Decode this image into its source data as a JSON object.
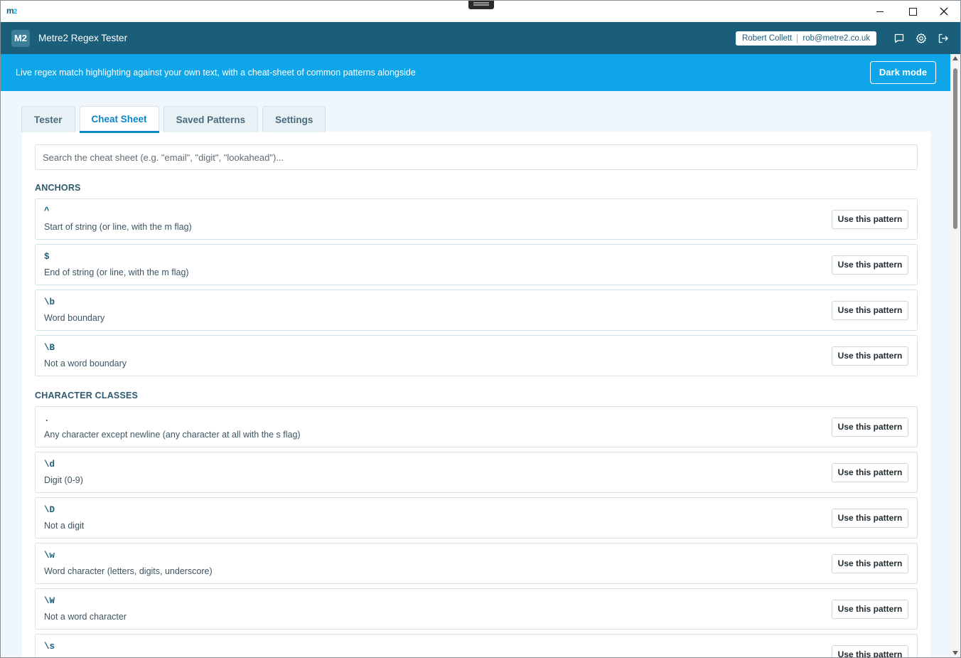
{
  "window": {
    "logo": "m",
    "logo_sub": "2"
  },
  "header": {
    "badge": "M2",
    "title": "Metre2 Regex Tester",
    "user_name": "Robert Collett",
    "user_email": "rob@metre2.co.uk"
  },
  "banner": {
    "text": "Live regex match highlighting against your own text, with a cheat-sheet of common patterns alongside",
    "dark_mode_label": "Dark mode"
  },
  "tabs": [
    {
      "label": "Tester"
    },
    {
      "label": "Cheat Sheet"
    },
    {
      "label": "Saved Patterns"
    },
    {
      "label": "Settings"
    }
  ],
  "active_tab": "Cheat Sheet",
  "search": {
    "placeholder": "Search the cheat sheet (e.g. \"email\", \"digit\", \"lookahead\")...",
    "value": ""
  },
  "use_label": "Use this pattern",
  "sections": [
    {
      "title": "ANCHORS",
      "items": [
        {
          "pattern": "^",
          "desc": "Start of string (or line, with the m flag)"
        },
        {
          "pattern": "$",
          "desc": "End of string (or line, with the m flag)"
        },
        {
          "pattern": "\\b",
          "desc": "Word boundary"
        },
        {
          "pattern": "\\B",
          "desc": "Not a word boundary"
        }
      ]
    },
    {
      "title": "CHARACTER CLASSES",
      "items": [
        {
          "pattern": ".",
          "desc": "Any character except newline (any character at all with the s flag)"
        },
        {
          "pattern": "\\d",
          "desc": "Digit (0-9)"
        },
        {
          "pattern": "\\D",
          "desc": "Not a digit"
        },
        {
          "pattern": "\\w",
          "desc": "Word character (letters, digits, underscore)"
        },
        {
          "pattern": "\\W",
          "desc": "Not a word character"
        },
        {
          "pattern": "\\s",
          "desc": ""
        }
      ]
    }
  ],
  "colors": {
    "header": "#1b5e7a",
    "banner": "#0ea5e9",
    "accent": "#0b84c6"
  }
}
